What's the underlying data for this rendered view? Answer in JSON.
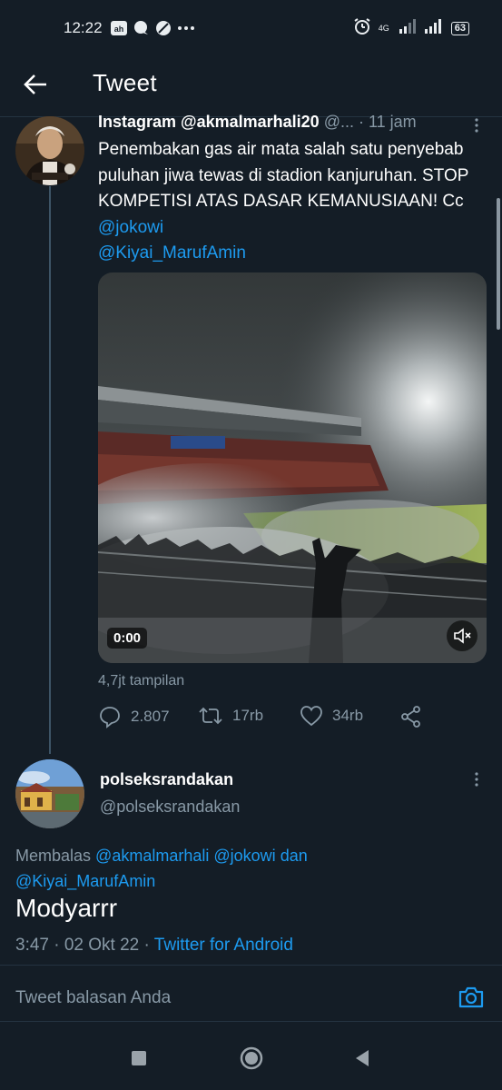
{
  "status_bar": {
    "time": "12:22",
    "network": "4G",
    "battery": "63"
  },
  "header": {
    "title": "Tweet"
  },
  "tweet": {
    "author_name": "Instagram @akmalmarhali20",
    "handle_truncated": "@...",
    "time": "· 11 jam",
    "text": "Penembakan gas air mata salah satu penyebab puluhan jiwa tewas di stadion kanjuruhan. STOP KOMPETISI ATAS DASAR KEMANUSIAAN! Cc ",
    "mention_1": "@jokowi",
    "mention_2": "@Kiyai_MarufAmin",
    "video_time": "0:00",
    "views": "4,7jt tampilan",
    "stats": {
      "replies": "2.807",
      "retweets": "17rb",
      "likes": "34rb"
    }
  },
  "reply": {
    "author_name": "polseksrandakan",
    "handle": "@polseksrandakan",
    "replying_prefix": "Membalas",
    "replying_to_1": "@akmalmarhali",
    "replying_to_2": "@jokowi",
    "replying_and": "dan",
    "replying_to_3": "@Kiyai_MarufAmin",
    "text": "Modyarrr",
    "timestamp": "3:47 · 02 Okt 22 ·",
    "client": "Twitter for Android"
  },
  "compose": {
    "placeholder": "Tweet balasan Anda"
  },
  "colors": {
    "background": "#141d26",
    "link": "#1d9bf0",
    "muted": "#8899a6"
  },
  "icons": [
    "back-arrow-icon",
    "more-vertical-icon",
    "reply-icon",
    "retweet-icon",
    "like-icon",
    "share-icon",
    "mute-icon",
    "camera-icon",
    "nav-recent-icon",
    "nav-home-icon",
    "nav-back-icon"
  ]
}
